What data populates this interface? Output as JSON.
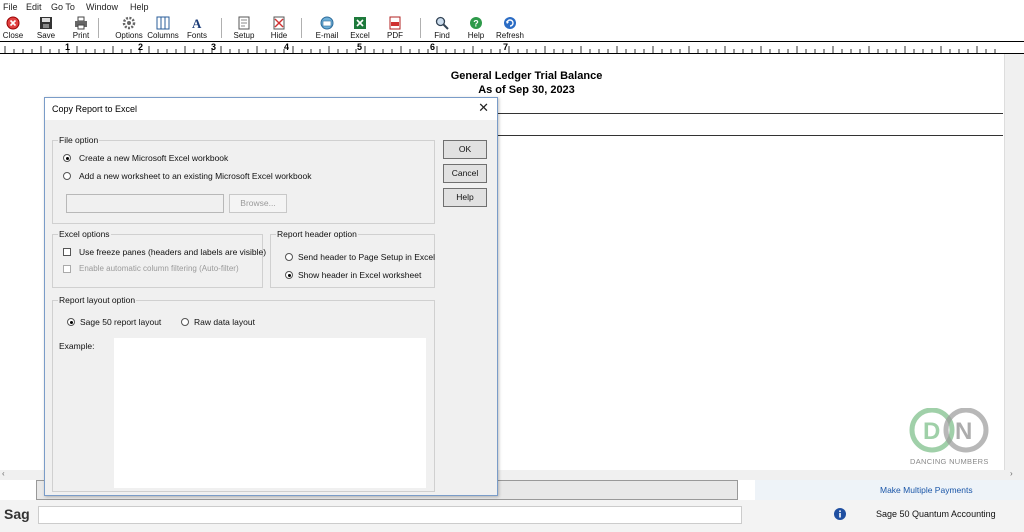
{
  "menu": [
    "File",
    "Edit",
    "Go To",
    "Window",
    "Help"
  ],
  "toolbar": {
    "close": "Close",
    "save": "Save",
    "print": "Print",
    "options": "Options",
    "columns": "Columns",
    "fonts": "Fonts",
    "setup": "Setup",
    "hide": "Hide",
    "email": "E-mail",
    "excel": "Excel",
    "pdf": "PDF",
    "find": "Find",
    "help": "Help",
    "refresh": "Refresh"
  },
  "ruler": [
    "1",
    "2",
    "3",
    "4",
    "5",
    "6",
    "7"
  ],
  "report": {
    "title": "General Ledger Trial Balance",
    "subtitle": "As of Sep 30, 2023"
  },
  "dialog": {
    "title": "Copy Report to Excel",
    "file_option": {
      "label": "File option",
      "new_workbook": "Create a new Microsoft Excel workbook",
      "existing_workbook": "Add a new worksheet to an existing Microsoft Excel workbook",
      "path_value": "",
      "browse": "Browse..."
    },
    "excel_options": {
      "label": "Excel options",
      "freeze": "Use freeze panes (headers and labels are visible)",
      "autofilter": "Enable automatic column filtering (Auto-filter)"
    },
    "header_option": {
      "label": "Report header option",
      "send_header": "Send header to Page Setup in Excel",
      "show_header": "Show header in Excel worksheet"
    },
    "layout_option": {
      "label": "Report layout option",
      "sage_layout": "Sage 50 report layout",
      "raw_layout": "Raw data layout",
      "example": "Example:"
    },
    "buttons": {
      "ok": "OK",
      "cancel": "Cancel",
      "help": "Help"
    }
  },
  "watermark": {
    "logo": "DN",
    "name": "DANCING NUMBERS"
  },
  "side_links": {
    "payments": "Make Multiple Payments"
  },
  "status": {
    "app": "Sage 50 Quantum Accounting",
    "left": "Sag"
  }
}
